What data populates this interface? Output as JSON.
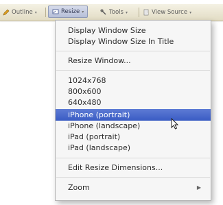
{
  "toolbar": {
    "items": [
      {
        "label": "Outline",
        "icon": "pencil-icon"
      },
      {
        "label": "Resize",
        "icon": "resize-icon"
      },
      {
        "label": "Tools",
        "icon": "wrench-icon"
      },
      {
        "label": "View Source",
        "icon": "document-icon"
      }
    ],
    "dropdown_glyph": "▾"
  },
  "menu": {
    "items": [
      {
        "label": "Display Window Size"
      },
      {
        "label": "Display Window Size In Title"
      },
      {
        "label": "Resize Window..."
      },
      {
        "label": "1024x768"
      },
      {
        "label": "800x600"
      },
      {
        "label": "640x480"
      },
      {
        "label": "iPhone (portrait)",
        "selected": true
      },
      {
        "label": "iPhone (landscape)"
      },
      {
        "label": "iPad (portrait)"
      },
      {
        "label": "iPad (landscape)"
      },
      {
        "label": "Edit Resize Dimensions..."
      },
      {
        "label": "Zoom",
        "submenu": true
      }
    ],
    "submenu_glyph": "▶"
  },
  "colors": {
    "selection": "#3f60c8",
    "menu_background": "#f6f6f6",
    "toolbar_background": "#ebe5cf"
  }
}
